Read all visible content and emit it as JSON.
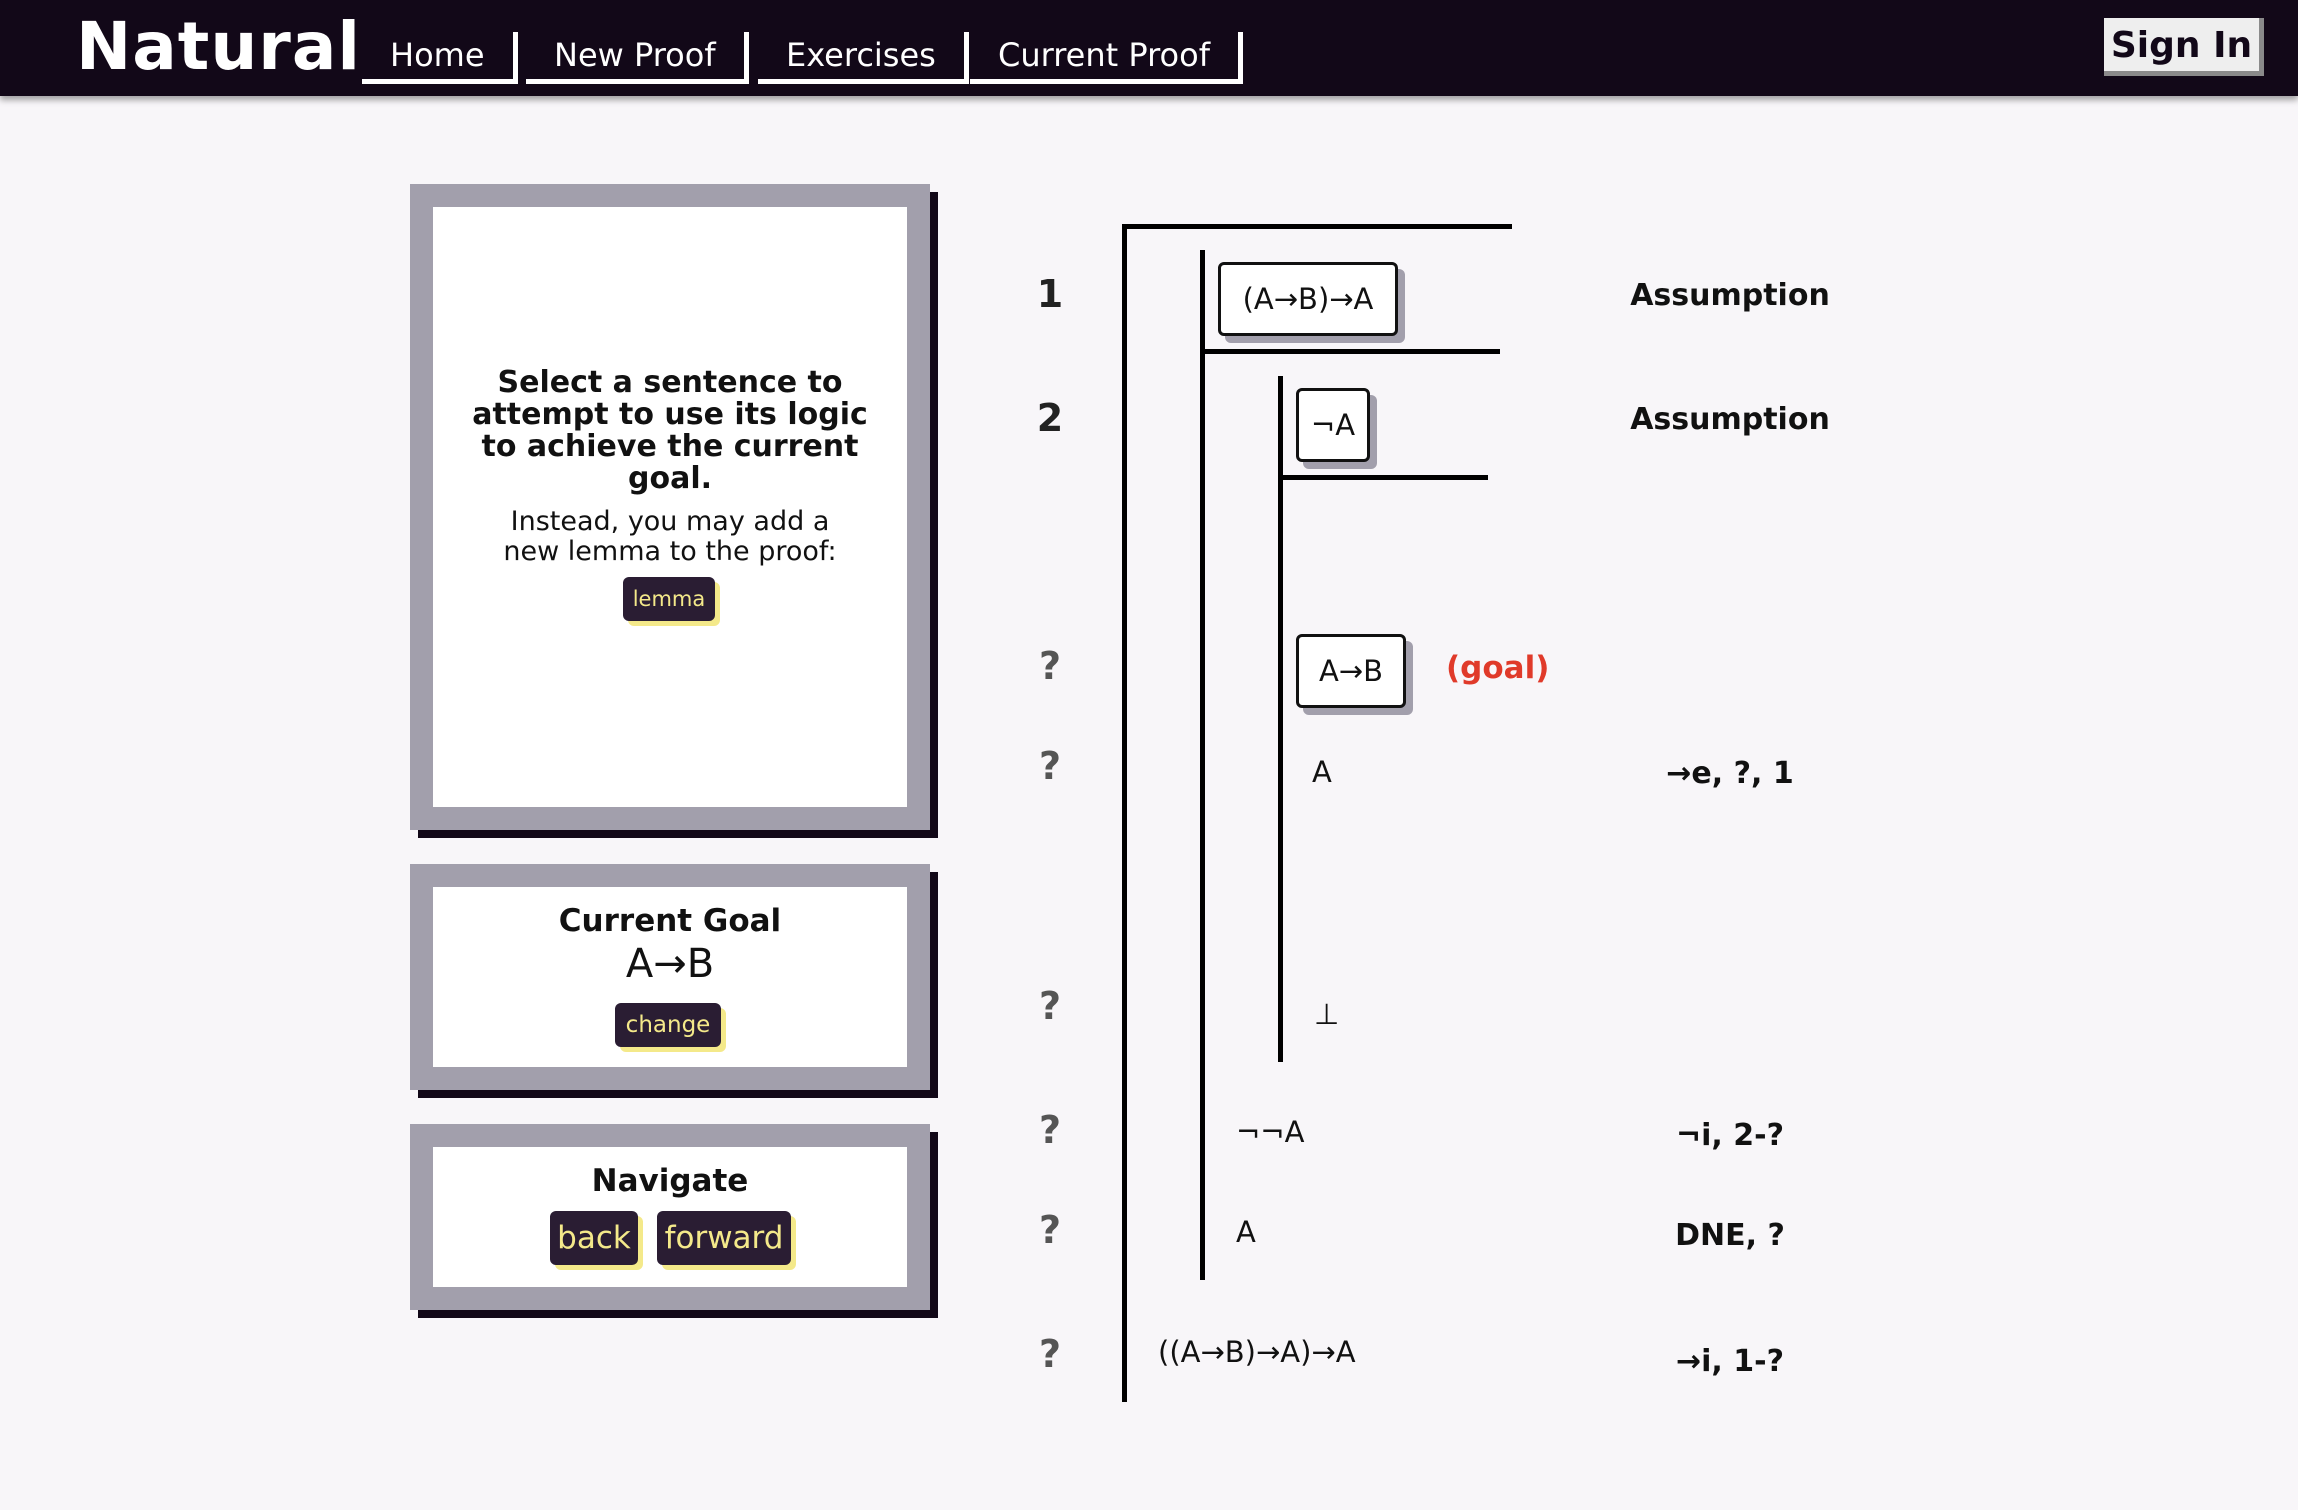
{
  "header": {
    "brand": "Natural",
    "nav": [
      "Home",
      "New Proof",
      "Exercises",
      "Current Proof"
    ],
    "sign_in": "Sign In"
  },
  "info_panel": {
    "heading": "Select a sentence to attempt to use its logic to achieve the current goal.",
    "text": "Instead, you may add a new lemma to the proof:",
    "lemma_button": "lemma"
  },
  "goal_panel": {
    "title": "Current Goal",
    "formula": "A→B",
    "change_button": "change"
  },
  "navigate_panel": {
    "title": "Navigate",
    "back_button": "back",
    "forward_button": "forward"
  },
  "proof": {
    "lines": [
      {
        "num": "1",
        "formula": "(A→B)→A",
        "justification": "Assumption"
      },
      {
        "num": "2",
        "formula": "¬A",
        "justification": "Assumption"
      },
      {
        "num": "?",
        "formula": "A→B",
        "goal_tag": "(goal)"
      },
      {
        "num": "?",
        "formula": "A",
        "justification": "→e, ?, 1"
      },
      {
        "num": "?",
        "formula": "⊥"
      },
      {
        "num": "?",
        "formula": "¬¬A",
        "justification": "¬i, 2-?"
      },
      {
        "num": "?",
        "formula": "A",
        "justification": "DNE, ?"
      },
      {
        "num": "?",
        "formula": "((A→B)→A)→A",
        "justification": "→i, 1-?"
      }
    ]
  }
}
